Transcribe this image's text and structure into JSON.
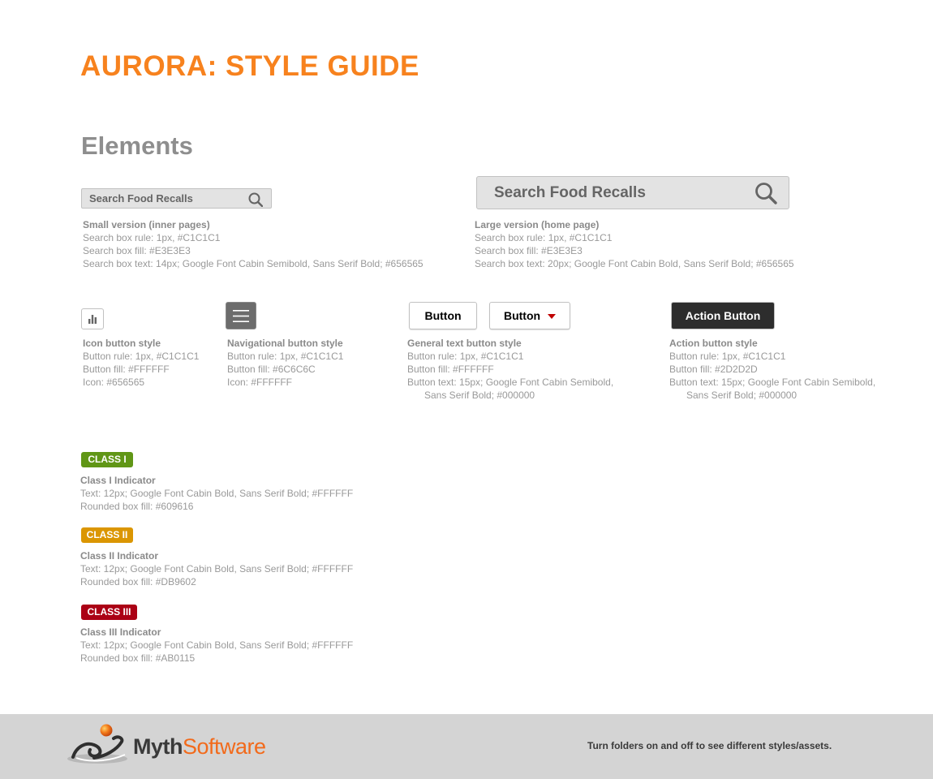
{
  "title": "AURORA: STYLE GUIDE",
  "section": "Elements",
  "search": {
    "small": {
      "text": "Search Food Recalls",
      "spec_head": "Small version (inner pages)",
      "spec_lines": [
        "Search box rule: 1px, #C1C1C1",
        "Search box fill: #E3E3E3",
        "Search box text: 14px; Google Font Cabin Semibold, Sans Serif Bold; #656565"
      ]
    },
    "large": {
      "text": "Search Food Recalls",
      "spec_head": "Large version (home page)",
      "spec_lines": [
        "Search box rule: 1px, #C1C1C1",
        "Search box fill: #E3E3E3",
        "Search box text: 20px; Google Font Cabin Bold, Sans Serif Bold; #656565"
      ]
    }
  },
  "buttons": {
    "icon_button": {
      "icon": "bar-chart-icon",
      "spec_head": "Icon button style",
      "spec_lines": [
        "Button rule: 1px, #C1C1C1",
        "Button fill: #FFFFFF",
        "Icon: #656565"
      ]
    },
    "nav_button": {
      "icon": "hamburger-menu-icon",
      "spec_head": "Navigational  button style",
      "spec_lines": [
        "Button rule: 1px, #C1C1C1",
        "Button fill: #6C6C6C",
        "Icon: #FFFFFF"
      ]
    },
    "general_button": {
      "label": "Button",
      "dropdown_label": "Button",
      "dropdown_icon": "caret-down-icon",
      "spec_head": "General text button style",
      "spec_lines": [
        "Button rule: 1px, #C1C1C1",
        "Button fill: #FFFFFF",
        "Button text: 15px; Google Font Cabin Semibold,"
      ],
      "spec_indent": "Sans Serif Bold; #000000"
    },
    "action_button": {
      "label": "Action Button",
      "spec_head": "Action button style",
      "spec_lines": [
        "Button rule: 1px, #C1C1C1",
        "Button fill: #2D2D2D",
        "Button text: 15px; Google Font Cabin Semibold,"
      ],
      "spec_indent": "Sans Serif Bold; #000000"
    }
  },
  "classes": [
    {
      "label": "CLASS I",
      "color": "#609616",
      "spec_head": "Class I Indicator",
      "spec_lines": [
        "Text: 12px; Google Font Cabin Bold, Sans Serif Bold; #FFFFFF",
        "Rounded box fill: #609616"
      ]
    },
    {
      "label": "CLASS II",
      "color": "#DB9602",
      "spec_head": "Class II Indicator",
      "spec_lines": [
        "Text: 12px; Google Font Cabin Bold, Sans Serif Bold; #FFFFFF",
        "Rounded box fill: #DB9602"
      ]
    },
    {
      "label": "CLASS III",
      "color": "#AB0115",
      "spec_head": "Class III Indicator",
      "spec_lines": [
        "Text: 12px; Google Font Cabin Bold, Sans Serif Bold; #FFFFFF",
        "Rounded box fill: #AB0115"
      ]
    }
  ],
  "footer": {
    "logo_main": "Myth",
    "logo_accent": "Software",
    "note": "Turn folders on and off to see different styles/assets."
  },
  "colors": {
    "accent": "#F7821E",
    "search_fill": "#E3E3E3",
    "rule": "#C1C1C1",
    "footer_bg": "#D4D4D4"
  }
}
